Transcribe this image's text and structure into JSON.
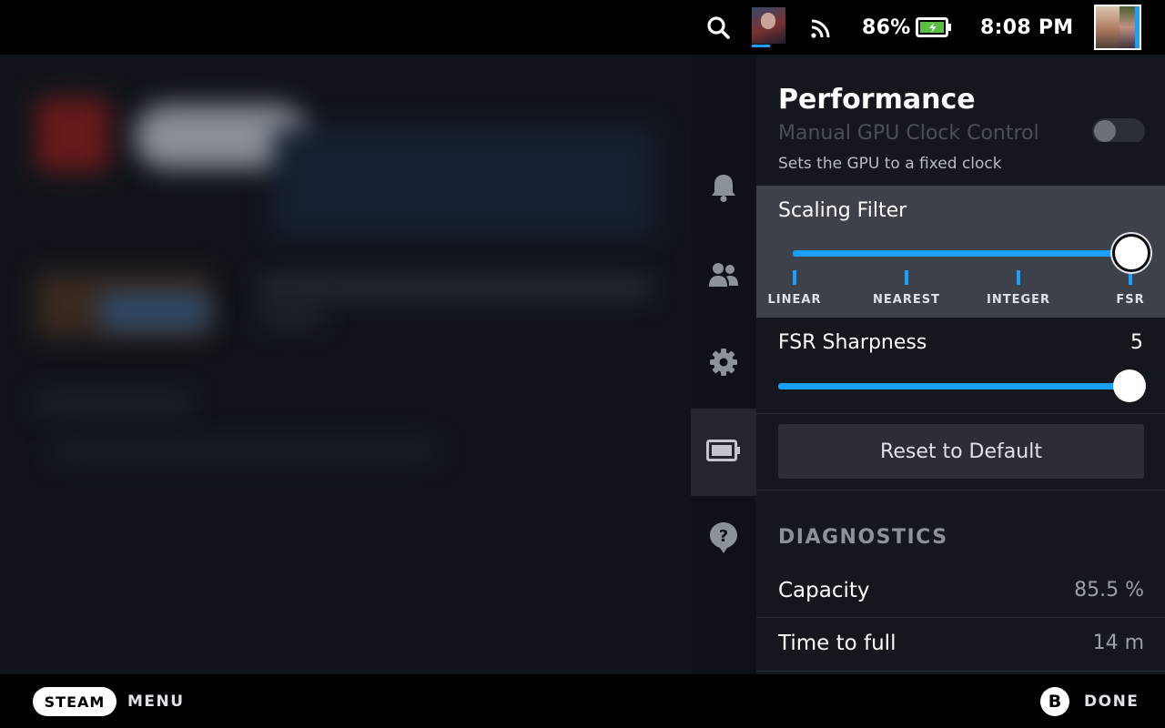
{
  "status_bar": {
    "battery_percent": "86%",
    "time": "8:08 PM",
    "icons": [
      "search-icon",
      "game-thumbnail",
      "wifi-icon",
      "battery-charging-icon",
      "user-avatar"
    ]
  },
  "rail": {
    "items": [
      {
        "icon": "bell-icon",
        "name": "notifications"
      },
      {
        "icon": "friends-icon",
        "name": "friends"
      },
      {
        "icon": "gear-icon",
        "name": "settings"
      },
      {
        "icon": "battery-icon",
        "name": "performance",
        "active": true
      },
      {
        "icon": "help-icon",
        "name": "help"
      }
    ]
  },
  "panel": {
    "title": "Performance",
    "manual_gpu": {
      "label": "Manual GPU Clock Control",
      "description": "Sets the GPU to a fixed clock",
      "enabled": false
    },
    "scaling_filter": {
      "label": "Scaling Filter",
      "options": [
        "LINEAR",
        "NEAREST",
        "INTEGER",
        "FSR"
      ],
      "selected": "FSR"
    },
    "fsr_sharpness": {
      "label": "FSR Sharpness",
      "value": "5",
      "level_fraction": 1.0
    },
    "reset_label": "Reset to Default",
    "diagnostics": {
      "heading": "DIAGNOSTICS",
      "rows": [
        {
          "label": "Capacity",
          "value": "85.5 %"
        },
        {
          "label": "Time to full",
          "value": "14 m"
        }
      ]
    }
  },
  "bottom_bar": {
    "steam_label": "STEAM",
    "menu_label": "MENU",
    "b_label": "B",
    "done_label": "DONE"
  },
  "colors": {
    "accent": "#1a9fff",
    "highlight_row": "#3d414a",
    "panel_bg": "#14171d",
    "battery_green": "#59bf40"
  }
}
